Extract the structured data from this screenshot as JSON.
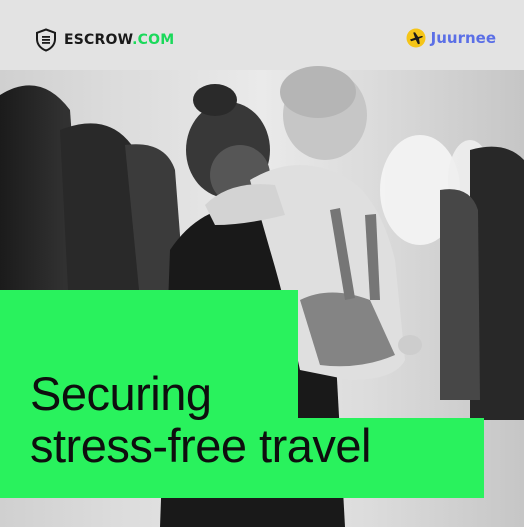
{
  "brands": {
    "escrow": {
      "name": "ESCROW",
      "domain": ".COM",
      "icon": "shield-icon",
      "accent": "#1bd95b"
    },
    "juurnee": {
      "name": "Juurnee",
      "icon": "airplane-icon",
      "icon_bg": "#f5c518",
      "color": "#5b6fe6"
    }
  },
  "headline": {
    "line1": "Securing",
    "line2": "stress-free travel"
  },
  "colors": {
    "panel_green": "#29f25d",
    "text_dark": "#0e0e0e"
  }
}
